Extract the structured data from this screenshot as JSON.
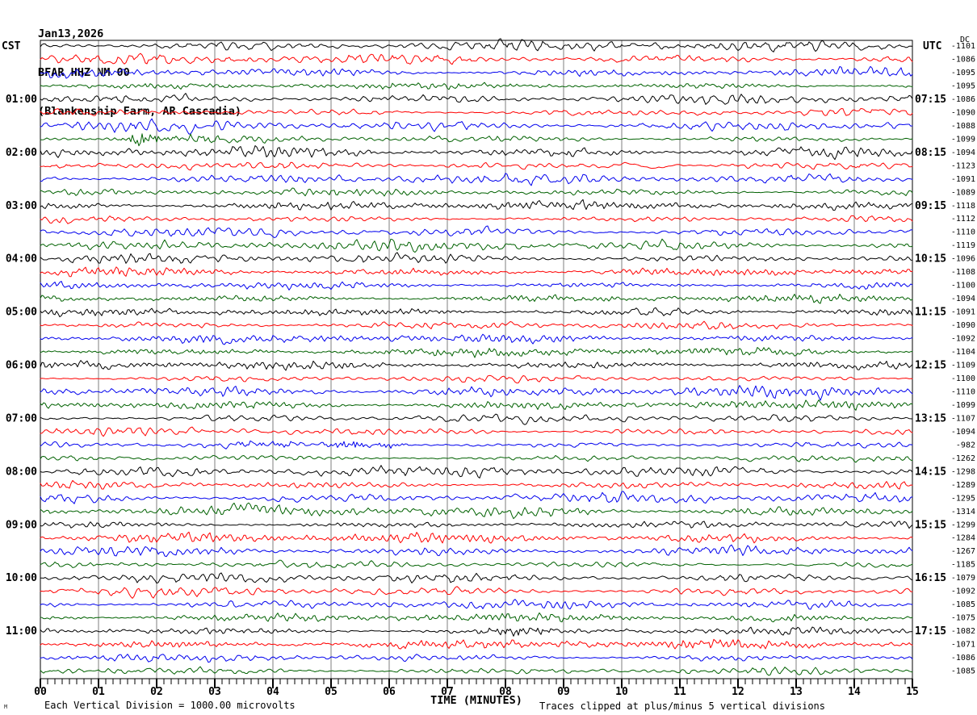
{
  "header": {
    "date": "Jan13,2026",
    "station": "BFAR HHZ NM 00",
    "location": "(Blankenship Farm, AR Cascadia)"
  },
  "footer": {
    "scale_note": "Each Vertical Division = 1000.00 microvolts",
    "clip_note": "Traces clipped at plus/minus 5 vertical divisions",
    "watermark": "M"
  },
  "chart_data": {
    "type": "line",
    "title": "BFAR HHZ NM 00 helicorder seismogram",
    "xlabel": "TIME (MINUTES)",
    "x_range_minutes": [
      0,
      15
    ],
    "x_ticks": [
      "00",
      "01",
      "02",
      "03",
      "04",
      "05",
      "06",
      "07",
      "08",
      "09",
      "10",
      "11",
      "12",
      "13",
      "14",
      "15"
    ],
    "minor_ticks_per_minute": 8,
    "left_axis_label": "CST",
    "right_axis_label": "UTC",
    "dc_header": "DC",
    "grid": true,
    "grid_color": "#7f7f7f",
    "frame_color": "#000000",
    "trace_colors": {
      "black": "#000000",
      "red": "#ff0000",
      "blue": "#0000ee",
      "green": "#006100"
    },
    "rows": [
      {
        "color": "black",
        "cst": null,
        "utc": null,
        "dc": -1101,
        "events": []
      },
      {
        "color": "red",
        "cst": null,
        "utc": null,
        "dc": -1086,
        "events": []
      },
      {
        "color": "blue",
        "cst": null,
        "utc": null,
        "dc": -1095,
        "events": []
      },
      {
        "color": "green",
        "cst": null,
        "utc": null,
        "dc": -1095,
        "events": []
      },
      {
        "color": "black",
        "cst": "01:00",
        "utc": "07:15",
        "dc": -1086,
        "events": []
      },
      {
        "color": "red",
        "cst": null,
        "utc": null,
        "dc": -1090,
        "events": []
      },
      {
        "color": "blue",
        "cst": null,
        "utc": null,
        "dc": -1088,
        "events": []
      },
      {
        "color": "green",
        "cst": null,
        "utc": null,
        "dc": -1099,
        "events": [
          {
            "start_min": 1.5,
            "end_min": 2.15,
            "amp": 8,
            "type": "burst"
          },
          {
            "start_min": 2.15,
            "end_min": 3.3,
            "amp": 2.5,
            "type": "burst"
          }
        ]
      },
      {
        "color": "black",
        "cst": "02:00",
        "utc": "08:15",
        "dc": -1094,
        "events": []
      },
      {
        "color": "red",
        "cst": null,
        "utc": null,
        "dc": -1123,
        "events": [
          {
            "start_min": 9.6,
            "end_min": 11.0,
            "amp": 3.2,
            "type": "lowfreq"
          }
        ]
      },
      {
        "color": "blue",
        "cst": null,
        "utc": null,
        "dc": -1091,
        "events": []
      },
      {
        "color": "green",
        "cst": null,
        "utc": null,
        "dc": -1089,
        "events": []
      },
      {
        "color": "black",
        "cst": "03:00",
        "utc": "09:15",
        "dc": -1118,
        "events": []
      },
      {
        "color": "red",
        "cst": null,
        "utc": null,
        "dc": -1112,
        "events": []
      },
      {
        "color": "blue",
        "cst": null,
        "utc": null,
        "dc": -1110,
        "events": []
      },
      {
        "color": "green",
        "cst": null,
        "utc": null,
        "dc": -1119,
        "events": []
      },
      {
        "color": "black",
        "cst": "04:00",
        "utc": "10:15",
        "dc": -1096,
        "events": []
      },
      {
        "color": "red",
        "cst": null,
        "utc": null,
        "dc": -1108,
        "events": []
      },
      {
        "color": "blue",
        "cst": null,
        "utc": null,
        "dc": -1100,
        "events": []
      },
      {
        "color": "green",
        "cst": null,
        "utc": null,
        "dc": -1094,
        "events": []
      },
      {
        "color": "black",
        "cst": "05:00",
        "utc": "11:15",
        "dc": -1091,
        "events": [
          {
            "start_min": 10.0,
            "end_min": 11.3,
            "amp": 3.2,
            "type": "wave"
          }
        ]
      },
      {
        "color": "red",
        "cst": null,
        "utc": null,
        "dc": -1090,
        "events": []
      },
      {
        "color": "blue",
        "cst": null,
        "utc": null,
        "dc": -1092,
        "events": []
      },
      {
        "color": "green",
        "cst": null,
        "utc": null,
        "dc": -1104,
        "events": []
      },
      {
        "color": "black",
        "cst": "06:00",
        "utc": "12:15",
        "dc": -1109,
        "events": []
      },
      {
        "color": "red",
        "cst": null,
        "utc": null,
        "dc": -1100,
        "events": []
      },
      {
        "color": "blue",
        "cst": null,
        "utc": null,
        "dc": -1110,
        "events": []
      },
      {
        "color": "green",
        "cst": null,
        "utc": null,
        "dc": -1099,
        "events": []
      },
      {
        "color": "black",
        "cst": "07:00",
        "utc": "13:15",
        "dc": -1107,
        "events": []
      },
      {
        "color": "red",
        "cst": null,
        "utc": null,
        "dc": -1094,
        "events": []
      },
      {
        "color": "blue",
        "cst": null,
        "utc": null,
        "dc": -982,
        "events": [
          {
            "start_min": 2.8,
            "end_min": 4.9,
            "amp": 1.8,
            "type": "burst"
          },
          {
            "start_min": 4.9,
            "end_min": 6.2,
            "amp": 4,
            "type": "burst"
          }
        ]
      },
      {
        "color": "green",
        "cst": null,
        "utc": null,
        "dc": -1262,
        "events": []
      },
      {
        "color": "black",
        "cst": "08:00",
        "utc": "14:15",
        "dc": -1298,
        "events": []
      },
      {
        "color": "red",
        "cst": null,
        "utc": null,
        "dc": -1289,
        "events": []
      },
      {
        "color": "blue",
        "cst": null,
        "utc": null,
        "dc": -1295,
        "events": []
      },
      {
        "color": "green",
        "cst": null,
        "utc": null,
        "dc": -1314,
        "events": []
      },
      {
        "color": "black",
        "cst": "09:00",
        "utc": "15:15",
        "dc": -1299,
        "events": []
      },
      {
        "color": "red",
        "cst": null,
        "utc": null,
        "dc": -1284,
        "events": []
      },
      {
        "color": "blue",
        "cst": null,
        "utc": null,
        "dc": -1267,
        "events": []
      },
      {
        "color": "green",
        "cst": null,
        "utc": null,
        "dc": -1185,
        "events": []
      },
      {
        "color": "black",
        "cst": "10:00",
        "utc": "16:15",
        "dc": -1079,
        "events": []
      },
      {
        "color": "red",
        "cst": null,
        "utc": null,
        "dc": -1092,
        "events": []
      },
      {
        "color": "blue",
        "cst": null,
        "utc": null,
        "dc": -1085,
        "events": []
      },
      {
        "color": "green",
        "cst": null,
        "utc": null,
        "dc": -1075,
        "events": []
      },
      {
        "color": "black",
        "cst": "11:00",
        "utc": "17:15",
        "dc": -1082,
        "events": [
          {
            "start_min": 7.5,
            "end_min": 8.8,
            "amp": 3.2,
            "type": "burst"
          }
        ]
      },
      {
        "color": "red",
        "cst": null,
        "utc": null,
        "dc": -1071,
        "events": []
      },
      {
        "color": "blue",
        "cst": null,
        "utc": null,
        "dc": -1086,
        "events": []
      },
      {
        "color": "green",
        "cst": null,
        "utc": null,
        "dc": -1085,
        "events": []
      }
    ]
  }
}
